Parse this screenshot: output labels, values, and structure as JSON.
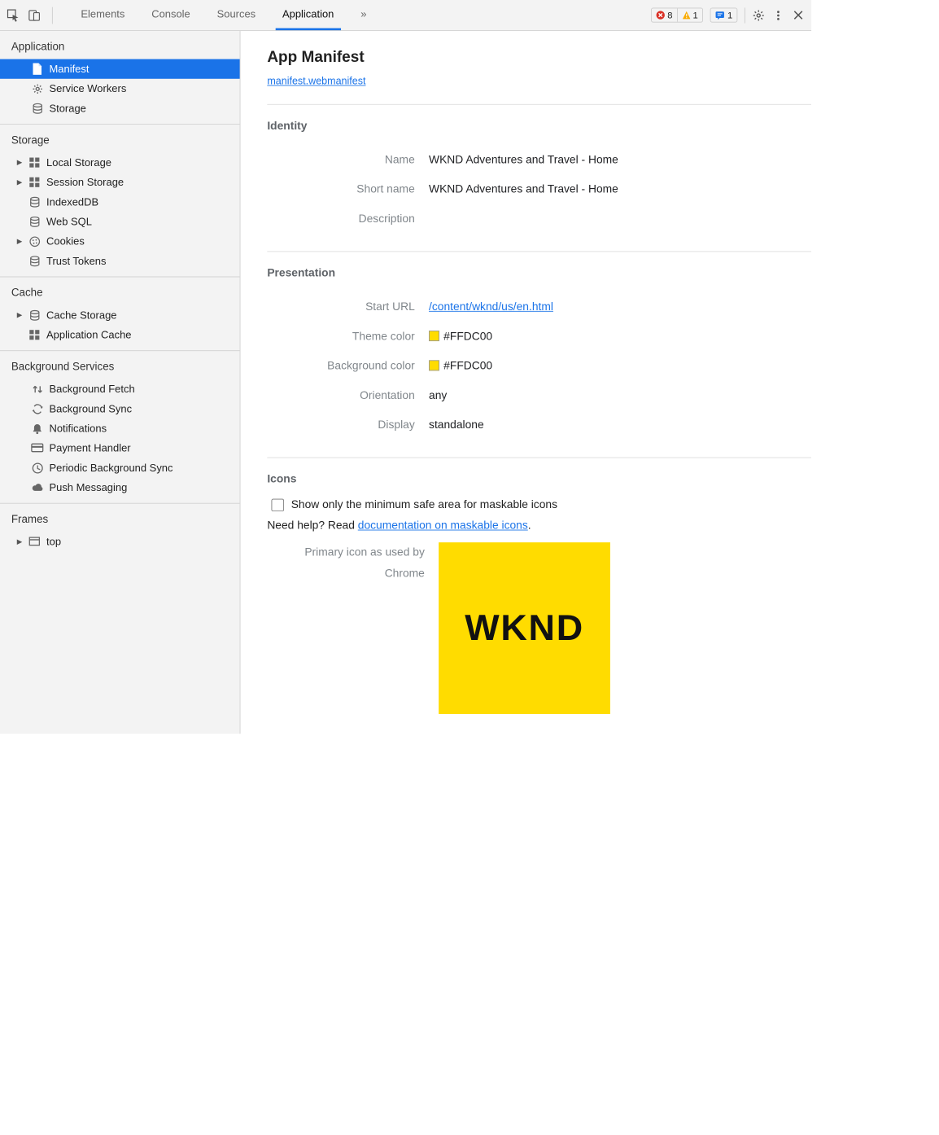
{
  "toolbar": {
    "tabs": [
      "Elements",
      "Console",
      "Sources",
      "Application"
    ],
    "active": "Application",
    "overflow": "»",
    "error_count": "8",
    "warning_count": "1",
    "message_count": "1"
  },
  "sidebar": {
    "sections": {
      "application": {
        "title": "Application",
        "items": [
          "Manifest",
          "Service Workers",
          "Storage"
        ]
      },
      "storage": {
        "title": "Storage",
        "items": [
          "Local Storage",
          "Session Storage",
          "IndexedDB",
          "Web SQL",
          "Cookies",
          "Trust Tokens"
        ]
      },
      "cache": {
        "title": "Cache",
        "items": [
          "Cache Storage",
          "Application Cache"
        ]
      },
      "background": {
        "title": "Background Services",
        "items": [
          "Background Fetch",
          "Background Sync",
          "Notifications",
          "Payment Handler",
          "Periodic Background Sync",
          "Push Messaging"
        ]
      },
      "frames": {
        "title": "Frames",
        "items": [
          "top"
        ]
      }
    }
  },
  "main": {
    "title": "App Manifest",
    "manifest_link": "manifest.webmanifest",
    "identity": {
      "heading": "Identity",
      "name_label": "Name",
      "name_value": "WKND Adventures and Travel - Home",
      "short_label": "Short name",
      "short_value": "WKND Adventures and Travel - Home",
      "desc_label": "Description",
      "desc_value": ""
    },
    "presentation": {
      "heading": "Presentation",
      "start_url_label": "Start URL",
      "start_url_value": "/content/wknd/us/en.html",
      "theme_label": "Theme color",
      "theme_value": "#FFDC00",
      "bg_label": "Background color",
      "bg_value": "#FFDC00",
      "orientation_label": "Orientation",
      "orientation_value": "any",
      "display_label": "Display",
      "display_value": "standalone"
    },
    "icons": {
      "heading": "Icons",
      "maskable_label": "Show only the minimum safe area for maskable icons",
      "help_prefix": "Need help? Read ",
      "help_link": "documentation on maskable icons",
      "help_suffix": ".",
      "primary_label_l1": "Primary icon as used by",
      "primary_label_l2": "Chrome",
      "logo_text": "WKND",
      "swatch_color": "#FFDC00"
    }
  }
}
